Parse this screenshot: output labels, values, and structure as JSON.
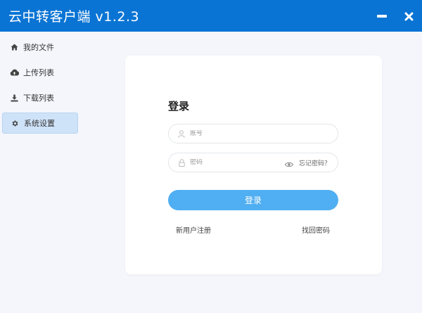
{
  "window": {
    "title": "云中转客户端 v1.2.3",
    "minimize_icon": "minimize-icon",
    "close_icon": "close-icon",
    "accent": "#0a74d4"
  },
  "sidebar": {
    "items": [
      {
        "label": "我的文件",
        "icon": "home-icon",
        "active": false
      },
      {
        "label": "上传列表",
        "icon": "cloud-upload-icon",
        "active": false
      },
      {
        "label": "下载列表",
        "icon": "download-icon",
        "active": false
      },
      {
        "label": "系统设置",
        "icon": "gear-icon",
        "active": true
      }
    ]
  },
  "login": {
    "title": "登录",
    "username_placeholder": "账号",
    "password_placeholder": "密码",
    "forgot_inline": "忘记密码？",
    "submit_label": "登录",
    "register_link": "新用户注册",
    "recover_link": "找回密码",
    "button_color": "#50aef2"
  }
}
